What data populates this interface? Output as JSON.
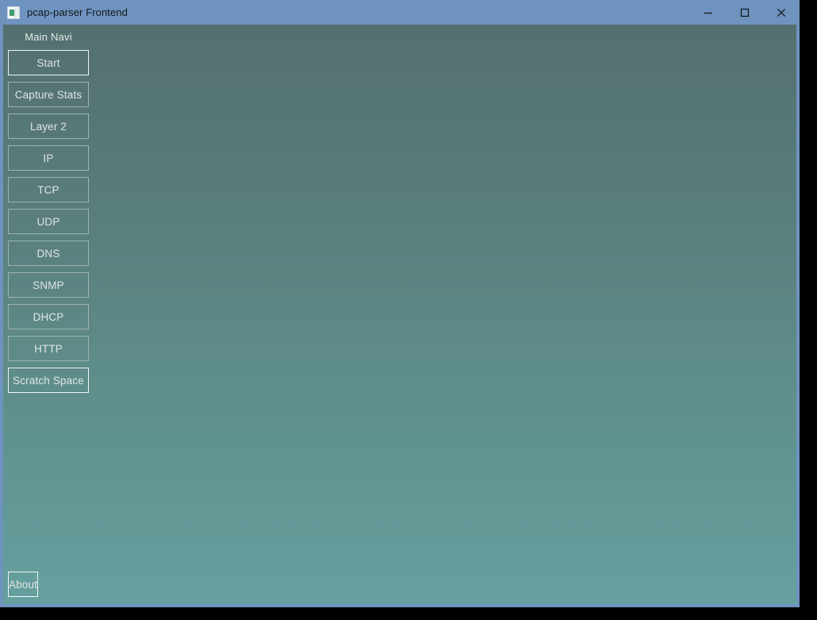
{
  "window": {
    "title": "pcap-parser Frontend",
    "icon": "app-icon",
    "controls": {
      "minimize_label": "Minimize",
      "maximize_label": "Maximize",
      "close_label": "Close"
    },
    "titlebar_color": "#6e93bf"
  },
  "sidebar": {
    "heading": "Main Navi",
    "items": [
      {
        "label": "Start",
        "focused": true
      },
      {
        "label": "Capture Stats",
        "focused": false
      },
      {
        "label": "Layer 2",
        "focused": false
      },
      {
        "label": "IP",
        "focused": false
      },
      {
        "label": "TCP",
        "focused": false
      },
      {
        "label": "UDP",
        "focused": false
      },
      {
        "label": "DNS",
        "focused": false
      },
      {
        "label": "SNMP",
        "focused": false
      },
      {
        "label": "DHCP",
        "focused": false
      },
      {
        "label": "HTTP",
        "focused": false
      },
      {
        "label": "Scratch Space",
        "focused": true
      }
    ],
    "footer": {
      "label": "About",
      "focused": true
    }
  },
  "main": {
    "content": "",
    "background_top_color": "#53706f",
    "background_bottom_color": "#65a09f"
  },
  "colors": {
    "accent": "#6e93bf",
    "panel_top": "#53706f",
    "panel_bottom": "#65a09f",
    "button_border": "#9db3b1",
    "button_border_focused": "#f2f5f5",
    "button_text": "#dfe5e4",
    "title_text": "#16181a"
  }
}
